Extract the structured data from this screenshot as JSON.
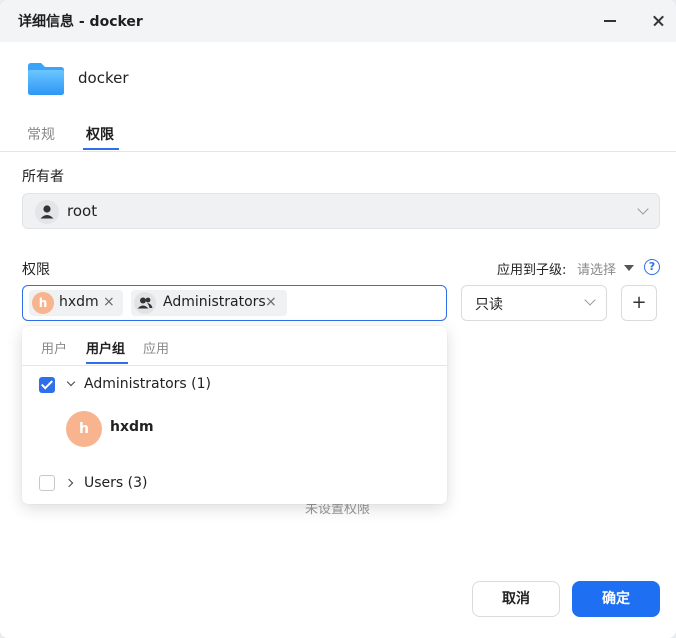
{
  "window": {
    "title": "详细信息 - docker"
  },
  "item": {
    "name": "docker",
    "icon": "folder-icon"
  },
  "tabs": [
    {
      "label": "常规",
      "active": false
    },
    {
      "label": "权限",
      "active": true
    }
  ],
  "owner": {
    "label": "所有者",
    "value": "root",
    "icon": "user-icon"
  },
  "permissions": {
    "label": "权限",
    "apply_label": "应用到子级:",
    "apply_value": "请选择",
    "help_icon_text": "?",
    "chips": [
      {
        "avatar_letter": "h",
        "name": "hxdm",
        "remove": "×"
      },
      {
        "name": "Administrators",
        "remove": "×",
        "icon": "user-group-icon"
      }
    ],
    "access_value": "只读",
    "add_symbol": "+",
    "empty_text": "未设置权限"
  },
  "dropdown": {
    "tabs": [
      {
        "label": "用户",
        "active": false
      },
      {
        "label": "用户组",
        "active": true
      },
      {
        "label": "应用",
        "active": false
      }
    ],
    "groups": [
      {
        "label": "Administrators (1)",
        "checked": true,
        "expanded": true,
        "members": [
          {
            "avatar_letter": "h",
            "name": "hxdm"
          }
        ]
      },
      {
        "label": "Users (3)",
        "checked": false,
        "expanded": false
      }
    ]
  },
  "actions": {
    "cancel": "取消",
    "ok": "确定"
  },
  "colors": {
    "accent": "#2f6feb",
    "primary_button": "#1f6ff3",
    "avatar_orange": "#f7b48e"
  }
}
